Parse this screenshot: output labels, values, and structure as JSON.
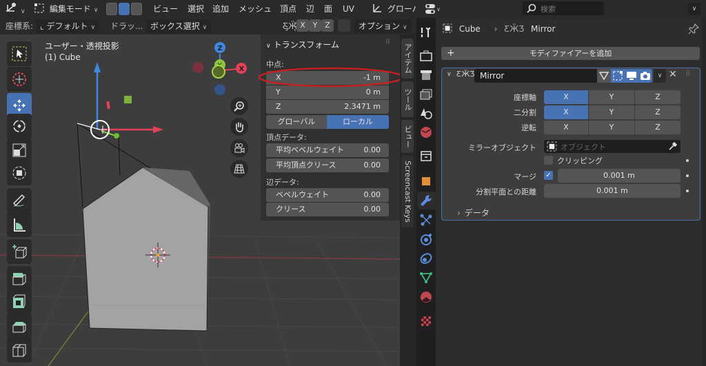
{
  "header": {
    "mode_label": "編集モード",
    "menus": [
      "ビュー",
      "選択",
      "追加",
      "メッシュ",
      "頂点",
      "辺",
      "面",
      "UV"
    ],
    "transform_orientation": "グローバ",
    "coord_label": "座標系:",
    "coord_value": "デフォルト",
    "drag_label": "ドラッ...",
    "select_box": "ボックス選択",
    "mirror_axes": [
      "X",
      "Y",
      "Z"
    ],
    "options_label": "オプション"
  },
  "viewport": {
    "view_name": "ユーザー・透視投影",
    "object_name": "(1) Cube",
    "gizmo_axes": {
      "x": "X",
      "y": "Y",
      "z": "Z"
    },
    "colors": {
      "x": "#e4405a",
      "y": "#8cc63f",
      "z": "#3f87e0"
    }
  },
  "npanel": {
    "title": "トランスフォーム",
    "median_label": "中点:",
    "fields": [
      {
        "label": "X",
        "value": "-1 m"
      },
      {
        "label": "Y",
        "value": "0 m"
      },
      {
        "label": "Z",
        "value": "2.3471 m"
      }
    ],
    "space_options": [
      "グローバル",
      "ローカル"
    ],
    "space_selected": "ローカル",
    "vertex_data_label": "頂点データ:",
    "vertex_fields": [
      {
        "label": "平均ベベルウェイト",
        "value": "0.00"
      },
      {
        "label": "平均頂点クリース",
        "value": "0.00"
      }
    ],
    "edge_data_label": "辺データ:",
    "edge_fields": [
      {
        "label": "ベベルウェイト",
        "value": "0.00"
      },
      {
        "label": "クリース",
        "value": "0.00"
      }
    ],
    "tabs": [
      "アイテム",
      "ツール",
      "ビュー",
      "Screencast Keys"
    ]
  },
  "properties": {
    "search_placeholder": "検索",
    "breadcrumb": [
      "Cube",
      "Mirror"
    ],
    "add_modifier": "モディファイアーを追加",
    "modifier": {
      "name": "Mirror",
      "axis_label": "座標軸",
      "bisect_label": "二分割",
      "flip_label": "逆転",
      "axes": [
        "X",
        "Y",
        "Z"
      ],
      "axis_on": [
        "X"
      ],
      "bisect_on": [
        "X"
      ],
      "mirror_object_label": "ミラーオブジェクト",
      "mirror_object_placeholder": "オブジェクト",
      "clipping_label": "クリッピング",
      "clipping_checked": false,
      "merge_label": "マージ",
      "merge_checked": true,
      "merge_value": "0.001 m",
      "bisect_distance_label": "分割平面との距離",
      "bisect_distance_value": "0.001 m",
      "data_label": "データ"
    }
  }
}
